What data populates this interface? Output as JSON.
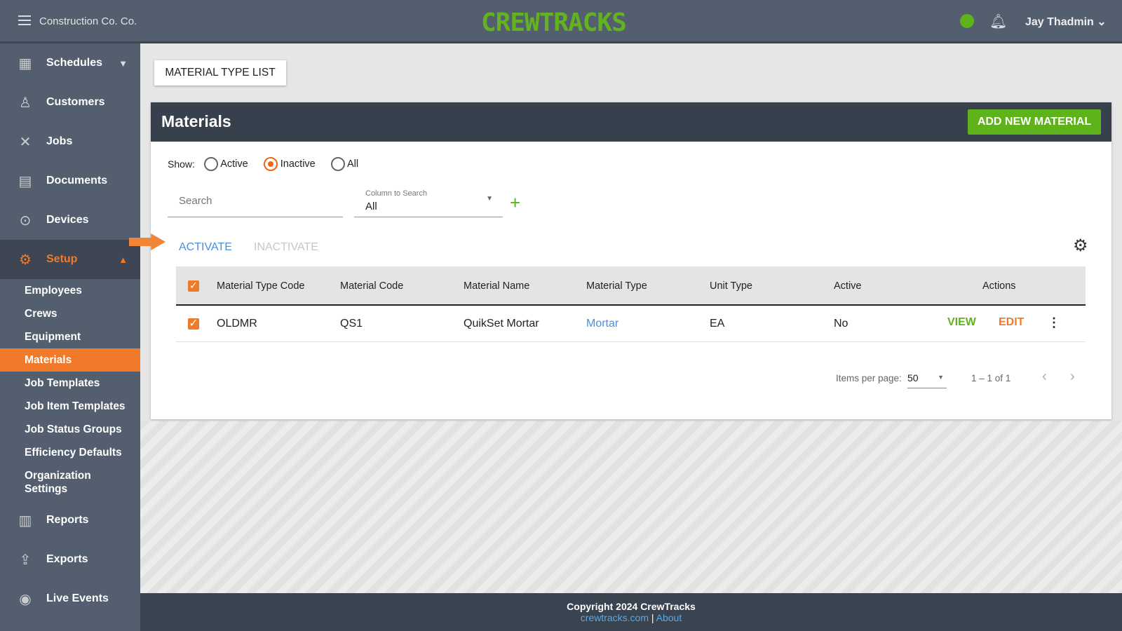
{
  "header": {
    "org_name": "Construction Co. Co.",
    "logo": "CREWTRACKS",
    "user_name": "Jay Thadmin",
    "status_color": "#5eb21a"
  },
  "sidebar": {
    "items": [
      {
        "label": "Schedules",
        "icon": "calendar-icon"
      },
      {
        "label": "Customers",
        "icon": "customer-icon"
      },
      {
        "label": "Jobs",
        "icon": "tools-icon"
      },
      {
        "label": "Documents",
        "icon": "documents-icon"
      },
      {
        "label": "Devices",
        "icon": "location-pin-icon"
      },
      {
        "label": "Setup",
        "icon": "gear-icon"
      },
      {
        "label": "Reports",
        "icon": "bar-chart-icon"
      },
      {
        "label": "Exports",
        "icon": "export-icon"
      },
      {
        "label": "Live Events",
        "icon": "broadcast-icon"
      }
    ],
    "setup_items": [
      "Employees",
      "Crews",
      "Equipment",
      "Materials",
      "Job Templates",
      "Job Item Templates",
      "Job Status Groups",
      "Efficiency Defaults",
      "Organization Settings"
    ]
  },
  "tab_label": "MATERIAL TYPE LIST",
  "card": {
    "title": "Materials",
    "add_button": "ADD NEW MATERIAL"
  },
  "filters": {
    "show_label": "Show:",
    "options": [
      "Active",
      "Inactive",
      "All"
    ],
    "selected": "Inactive",
    "search_placeholder": "Search",
    "column_label": "Column to Search",
    "column_value": "All"
  },
  "actions": {
    "activate": "ACTIVATE",
    "inactivate": "INACTIVATE"
  },
  "table": {
    "headers": [
      "Material Type Code",
      "Material Code",
      "Material Name",
      "Material Type",
      "Unit Type",
      "Active",
      "Actions"
    ],
    "rows": [
      {
        "type_code": "OLDMR",
        "code": "QS1",
        "name": "QuikSet Mortar",
        "type": "Mortar",
        "unit": "EA",
        "active": "No",
        "view": "VIEW",
        "edit": "EDIT"
      }
    ]
  },
  "pagination": {
    "label": "Items per page:",
    "per_page": "50",
    "range": "1 – 1 of 1"
  },
  "footer": {
    "copyright": "Copyright 2024 CrewTracks",
    "link": "crewtracks.com",
    "separator": "|",
    "about": "About"
  }
}
